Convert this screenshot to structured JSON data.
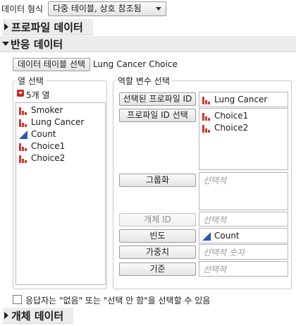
{
  "data_format": {
    "label": "데이터 형식",
    "value": "다중 테이블, 상호 참조됨"
  },
  "profile_section": {
    "title": "프로파일 데이터"
  },
  "response_section": {
    "title": "반응 데이터",
    "select_table_button": "데이터 테이블 선택",
    "selected_table": "Lung Cancer Choice",
    "column_select": {
      "legend": "열 선택",
      "count_label": "5개 열",
      "columns": [
        {
          "name": "Smoker",
          "type": "nominal"
        },
        {
          "name": "Lung Cancer",
          "type": "nominal"
        },
        {
          "name": "Count",
          "type": "continuous"
        },
        {
          "name": "Choice1",
          "type": "nominal"
        },
        {
          "name": "Choice2",
          "type": "nominal"
        }
      ]
    },
    "role_select": {
      "legend": "역할 변수 선택",
      "roles": {
        "selected_profile_id": {
          "button": "선택된 프로파일 ID",
          "value": "Lung Cancer"
        },
        "profile_id_select": {
          "button": "프로파일 ID 선택",
          "values": [
            "Choice1",
            "Choice2"
          ]
        },
        "grouping": {
          "button": "그룹화",
          "placeholder": "선택적"
        },
        "subject_id": {
          "button": "개체 ID",
          "placeholder": "선택적"
        },
        "frequency": {
          "button": "빈도",
          "value": "Count"
        },
        "weight": {
          "button": "가중치",
          "placeholder": "선택적 숫자"
        },
        "by": {
          "button": "기준",
          "placeholder": "선택적"
        }
      }
    },
    "checkbox_label": "응답자는 \"없음\" 또는 \"선택 안 함\"을 선택할 수 있음"
  },
  "subject_section": {
    "title": "개체 데이터"
  },
  "colors": {
    "nominal_icon": "#d23a2e",
    "continuous_icon": "#2f56b8",
    "menu_arrow": "#d12020"
  }
}
